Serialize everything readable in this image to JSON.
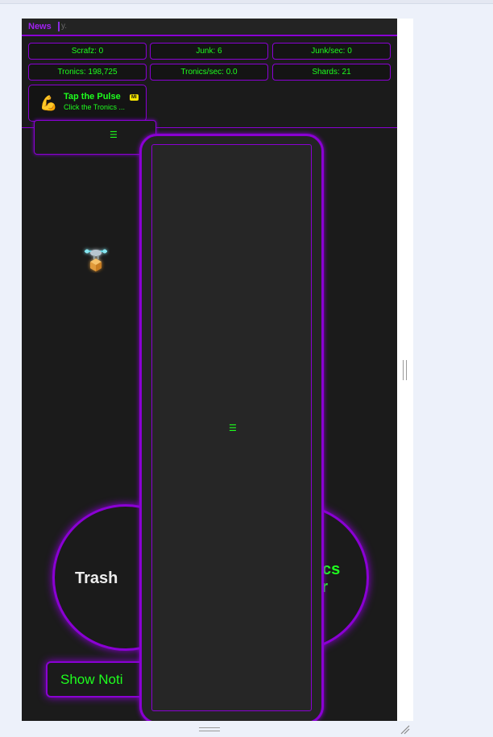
{
  "news": {
    "label": "News",
    "ticker": "y."
  },
  "stats": [
    {
      "text": "Scrafz: 0"
    },
    {
      "text": "Junk: 6"
    },
    {
      "text": "Junk/sec: 0"
    },
    {
      "text": "Tronics: 198,725"
    },
    {
      "text": "Tronics/sec: 0.0"
    },
    {
      "text": "Shards: 21"
    }
  ],
  "quest": {
    "icon": "flexed-biceps-icon",
    "title": "Tap the Pulse",
    "badge": "MI",
    "description": "Click the Tronics ..."
  },
  "buttons": {
    "trash": "Trash",
    "tronics_line1": "onics",
    "tronics_line2": "ker",
    "notifications": "Show Noti"
  },
  "colors": {
    "accent": "#8a00d4",
    "text": "#1eff1e",
    "background": "#1b1b1b"
  }
}
